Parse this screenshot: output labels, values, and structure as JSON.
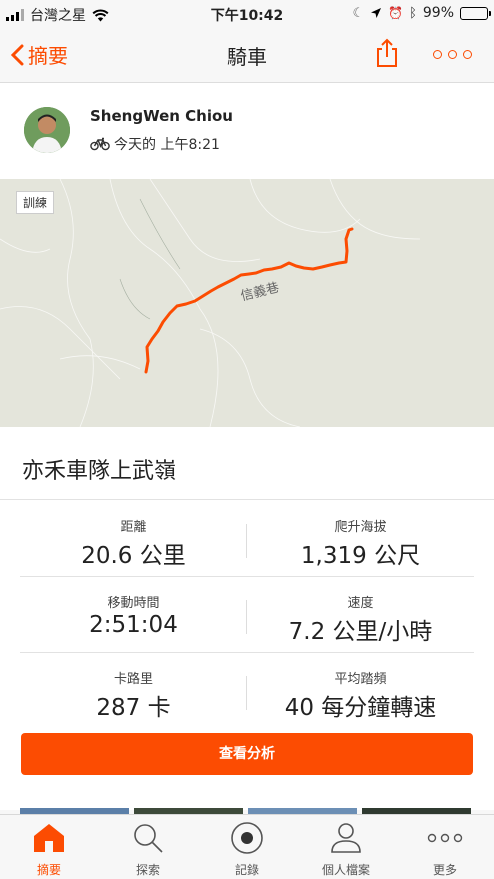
{
  "status_bar": {
    "carrier": "台灣之星",
    "time": "下午10:42",
    "battery": "99%",
    "battery_level": 0.99
  },
  "nav": {
    "back_label": "摘要",
    "title": "騎車"
  },
  "athlete": {
    "name": "ShengWen Chiou",
    "timestamp": "今天的 上午8:21"
  },
  "map": {
    "tag": "訓練",
    "road_label": "信義巷"
  },
  "activity": {
    "title": "亦禾車隊上武嶺"
  },
  "stats": [
    {
      "label": "距離",
      "value": "20.6 公里"
    },
    {
      "label": "爬升海拔",
      "value": "1,319 公尺"
    },
    {
      "label": "移動時間",
      "value": "2:51:04"
    },
    {
      "label": "速度",
      "value": "7.2 公里/小時"
    },
    {
      "label": "卡路里",
      "value": "287 卡"
    },
    {
      "label": "平均踏頻",
      "value": "40 每分鐘轉速"
    }
  ],
  "cta_label": "查看分析",
  "tabs": [
    {
      "label": "摘要",
      "icon": "home-icon",
      "active": true
    },
    {
      "label": "探索",
      "icon": "search-icon",
      "active": false
    },
    {
      "label": "記錄",
      "icon": "record-icon",
      "active": false
    },
    {
      "label": "個人檔案",
      "icon": "profile-icon",
      "active": false
    },
    {
      "label": "更多",
      "icon": "more-icon",
      "active": false
    }
  ],
  "colors": {
    "accent": "#fc4c02",
    "route": "#fc4c02"
  }
}
